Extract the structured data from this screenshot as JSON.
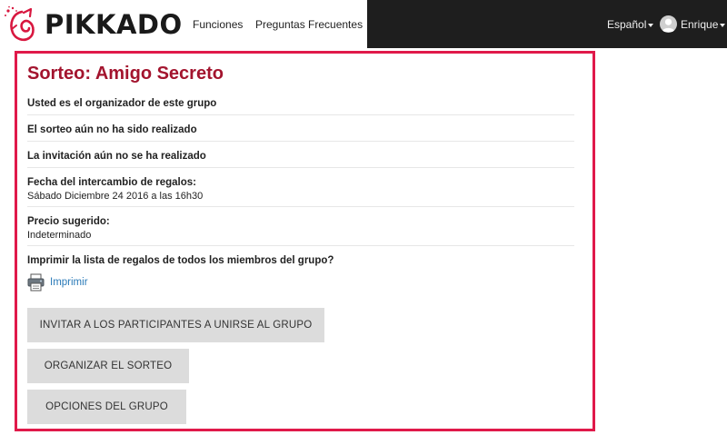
{
  "header": {
    "brand": "PIKKADO",
    "nav": [
      {
        "label": "Funciones"
      },
      {
        "label": "Preguntas Frecuentes"
      }
    ],
    "language": "Español",
    "user_name": "Enrique",
    "colors": {
      "dark_bg": "#1e1e1e",
      "brand_red": "#e0194a"
    }
  },
  "panel": {
    "title": "Sorteo: Amigo Secreto",
    "rows": [
      {
        "text": "Usted es el organizador de este grupo"
      },
      {
        "text": "El sorteo aún no ha sido realizado"
      },
      {
        "text": "La invitación aún no se ha realizado"
      },
      {
        "label": "Fecha del intercambio de regalos:",
        "value": "Sábado Diciembre 24 2016 a las 16h30"
      },
      {
        "label": "Precio sugerido:",
        "value": "Indeterminado"
      }
    ],
    "print_question": "Imprimir la lista de regalos de todos los miembros del grupo?",
    "print_link": "Imprimir",
    "buttons": [
      {
        "label": "INVITAR A LOS PARTICIPANTES A UNIRSE AL GRUPO"
      },
      {
        "label": "ORGANIZAR EL SORTEO"
      },
      {
        "label": "OPCIONES DEL GRUPO"
      }
    ],
    "colors": {
      "title": "#a3142e",
      "border": "#e0194a",
      "link": "#2a7ab8",
      "button_bg": "#dcdcdc"
    }
  }
}
